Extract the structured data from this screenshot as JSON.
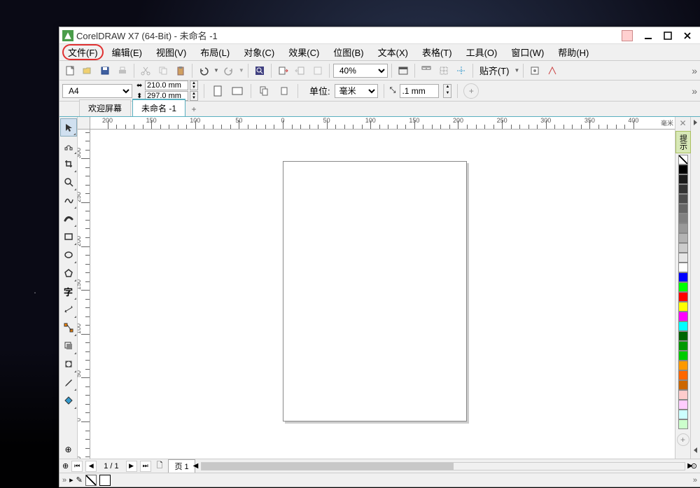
{
  "title": "CorelDRAW X7 (64-Bit) - 未命名 -1",
  "menu": {
    "file": "文件(F)",
    "edit": "编辑(E)",
    "view": "视图(V)",
    "layout": "布局(L)",
    "object": "对象(C)",
    "effect": "效果(C)",
    "bitmap": "位图(B)",
    "text": "文本(X)",
    "table": "表格(T)",
    "tool": "工具(O)",
    "window": "窗口(W)",
    "help": "帮助(H)"
  },
  "toolbar": {
    "zoom": "40%",
    "snap": "贴齐(T)"
  },
  "propbar": {
    "paper": "A4",
    "width": "210.0 mm",
    "height": "297.0 mm",
    "unit_label": "单位:",
    "unit": "毫米",
    "nudge": ".1 mm"
  },
  "tabs": {
    "welcome": "欢迎屏幕",
    "doc": "未命名 -1"
  },
  "ruler": {
    "unit_h": "毫米",
    "h": [
      "0",
      "50",
      "100",
      "150",
      "200",
      "250",
      "300",
      "350"
    ],
    "neg_h": [
      "50",
      "100",
      "150"
    ],
    "v": [
      "0",
      "50",
      "100",
      "150",
      "200",
      "250",
      "300"
    ]
  },
  "side_panel": {
    "hint": "提示"
  },
  "palette": [
    "#000000",
    "#1a1a1a",
    "#333333",
    "#4d4d4d",
    "#666666",
    "#808080",
    "#999999",
    "#b3b3b3",
    "#cccccc",
    "#e6e6e6",
    "#ffffff",
    "#0000ff",
    "#00ff00",
    "#ff0000",
    "#ffff00",
    "#ff00ff",
    "#00ffff",
    "#006600",
    "#009900",
    "#00cc00",
    "#ff9900",
    "#ff6600",
    "#cc6600",
    "#ffcccc",
    "#ffccff",
    "#ccffff",
    "#ccffcc"
  ],
  "status": {
    "page_of": "1 / 1",
    "page_tab": "页 1"
  }
}
